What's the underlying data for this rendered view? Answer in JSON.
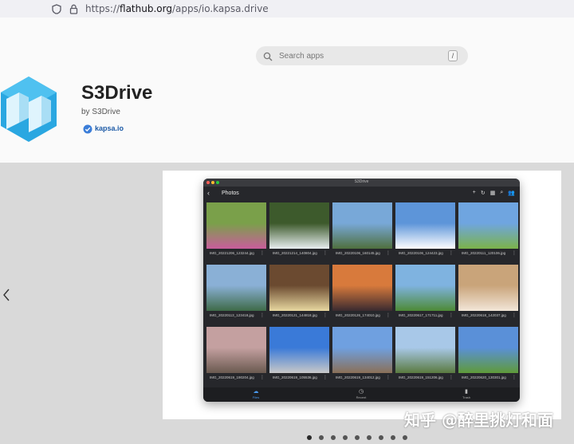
{
  "browser": {
    "url_prefix": "https://",
    "url_host": "flathub.org",
    "url_path": "/apps/io.kapsa.drive"
  },
  "search": {
    "placeholder": "Search apps",
    "shortcut": "/"
  },
  "app": {
    "name": "S3Drive",
    "by": "by S3Drive",
    "verified_domain": "kapsa.io"
  },
  "screenshot": {
    "window_title": "S3Drive",
    "page_title": "Photos",
    "photos": [
      {
        "name": "IMG_20221206_123244.jpg",
        "colors": [
          "#7aa04a",
          "#c95d9c"
        ]
      },
      {
        "name": "IMG_20221214_140804.jpg",
        "colors": [
          "#3d5a2c",
          "#e8eef0"
        ]
      },
      {
        "name": "IMG_20220106_160145.jpg",
        "colors": [
          "#78a8d8",
          "#4f6f3e"
        ]
      },
      {
        "name": "IMG_20220106_124423.jpg",
        "colors": [
          "#5d95d9",
          "#ffffff"
        ]
      },
      {
        "name": "IMG_20220111_120106.jpg",
        "colors": [
          "#6fa5e0",
          "#7bb34a"
        ]
      },
      {
        "name": "IMG_20220113_123418.jpg",
        "colors": [
          "#8ab0d6",
          "#3e6a48"
        ]
      },
      {
        "name": "IMG_20220121_144818.jpg",
        "colors": [
          "#6b4a30",
          "#e7d7a0"
        ]
      },
      {
        "name": "IMG_20220126_174010.jpg",
        "colors": [
          "#d87a3c",
          "#3a2a30"
        ]
      },
      {
        "name": "IMG_20220617_171711.jpg",
        "colors": [
          "#7fb3e0",
          "#4d8a36"
        ]
      },
      {
        "name": "IMG_20220618_142037.jpg",
        "colors": [
          "#c9a47a",
          "#f2e6d8"
        ]
      },
      {
        "name": "IMG_20220619_190204.jpg",
        "colors": [
          "#c4a0a0",
          "#6a5a50"
        ]
      },
      {
        "name": "IMG_20220619_105536.jpg",
        "colors": [
          "#3a7ad8",
          "#c8c8c8"
        ]
      },
      {
        "name": "IMG_20220619_134012.jpg",
        "colors": [
          "#6fa0e0",
          "#8a7058"
        ]
      },
      {
        "name": "IMG_20220619_151206.jpg",
        "colors": [
          "#a8c8e8",
          "#5a7a40"
        ]
      },
      {
        "name": "IMG_20220620_130301.jpg",
        "colors": [
          "#5a90d8",
          "#5f9a3a"
        ]
      }
    ],
    "nav": [
      "Files",
      "Recent",
      "Trash"
    ]
  },
  "pagination": {
    "count": 9,
    "active": 0
  },
  "watermark": "知乎 @醉里挑灯和面",
  "colors": {
    "accent": "#1c5aa6",
    "logo": "#29a8e0"
  }
}
